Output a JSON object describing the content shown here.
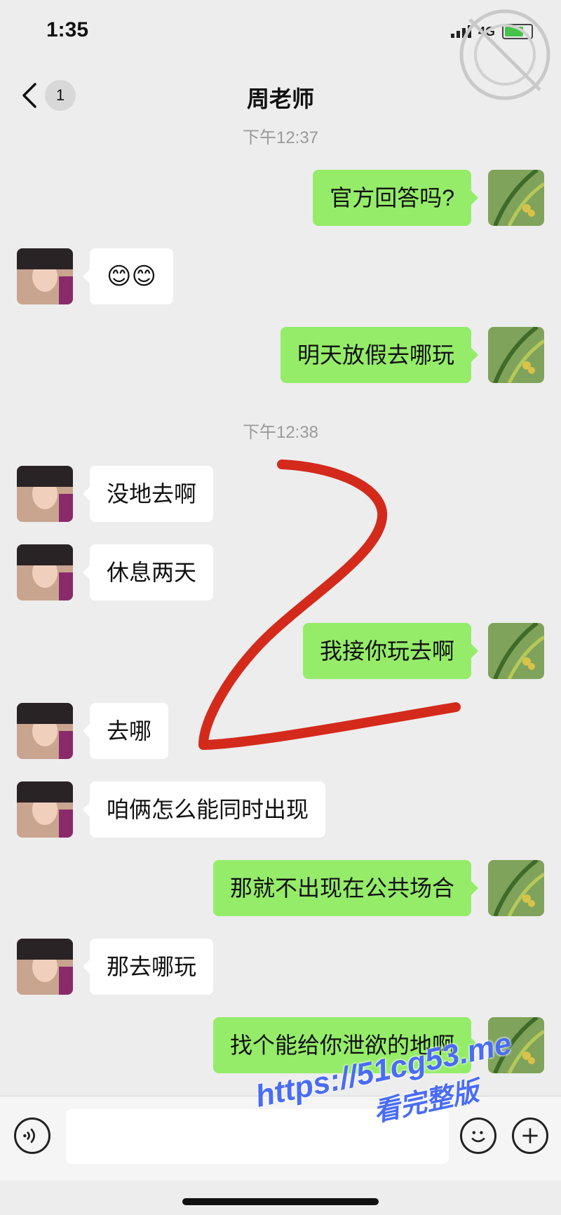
{
  "status_bar": {
    "time": "1:35",
    "network": "4G"
  },
  "nav": {
    "back_icon": "chevron-left-icon",
    "unread_count": "1",
    "title": "周老师"
  },
  "timestamps": [
    "下午12:37",
    "下午12:38"
  ],
  "messages": [
    {
      "side": "right",
      "text": "官方回答吗?"
    },
    {
      "side": "left",
      "text": "😊😊"
    },
    {
      "side": "right",
      "text": "明天放假去哪玩"
    },
    {
      "side": "left",
      "text": "没地去啊"
    },
    {
      "side": "left",
      "text": "休息两天"
    },
    {
      "side": "right",
      "text": "我接你玩去啊"
    },
    {
      "side": "left",
      "text": "去哪"
    },
    {
      "side": "left",
      "text": "咱俩怎么能同时出现"
    },
    {
      "side": "right",
      "text": "那就不出现在公共场合"
    },
    {
      "side": "left",
      "text": "那去哪玩"
    },
    {
      "side": "right",
      "text": "找个能给你泄欲的地啊"
    }
  ],
  "input_bar": {
    "voice_icon": "voice-icon",
    "input_value": "",
    "emoji_icon": "smiley-icon",
    "plus_icon": "plus-icon"
  },
  "watermark": {
    "url": "https://51cg53.me",
    "subtitle": "看完整版"
  },
  "colors": {
    "background": "#ededed",
    "outgoing_bubble": "#95ec69",
    "incoming_bubble": "#ffffff",
    "annotation_stroke": "#d42a1c",
    "watermark": "#4a6cf5"
  }
}
